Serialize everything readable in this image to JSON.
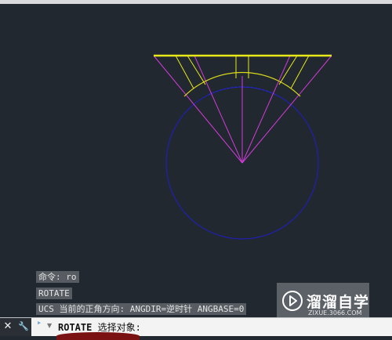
{
  "command_history": [
    "命令: ro",
    "ROTATE",
    "UCS 当前的正角方向:  ANGDIR=逆时针  ANGBASE=0"
  ],
  "command_line": {
    "command": "ROTATE",
    "prompt": "选择对象:"
  },
  "command_bar": {
    "close_glyph": "✕",
    "customize_glyph": "🔧"
  },
  "watermark": {
    "title": "溜溜自学",
    "url": "ZIXUE.3066.COM"
  },
  "colors": {
    "canvas": "#212830",
    "line_yellow": "#e8e81a",
    "line_magenta": "#d23bd8",
    "circle_blue": "#2020b0"
  }
}
